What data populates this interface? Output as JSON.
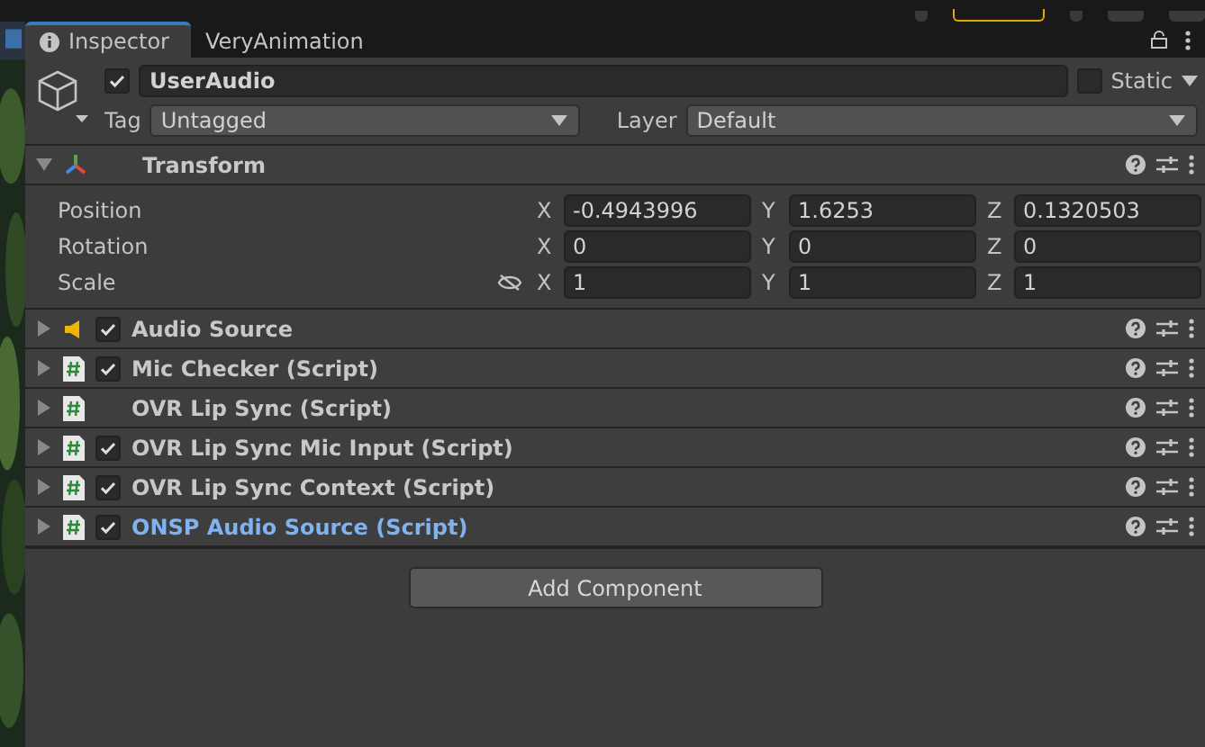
{
  "tabs": [
    {
      "label": "Inspector",
      "selected": true,
      "icon": true
    },
    {
      "label": "VeryAnimation",
      "selected": false,
      "icon": false
    }
  ],
  "object": {
    "active": true,
    "name": "UserAudio",
    "static": false,
    "static_label": "Static",
    "tag_label": "Tag",
    "tag": "Untagged",
    "layer_label": "Layer",
    "layer": "Default"
  },
  "transform": {
    "title": "Transform",
    "expanded": true,
    "rows": [
      {
        "label": "Position",
        "link_icon": false,
        "values": [
          {
            "axis": "X",
            "value": "-0.4943996"
          },
          {
            "axis": "Y",
            "value": "1.6253"
          },
          {
            "axis": "Z",
            "value": "0.1320503"
          }
        ]
      },
      {
        "label": "Rotation",
        "link_icon": false,
        "values": [
          {
            "axis": "X",
            "value": "0"
          },
          {
            "axis": "Y",
            "value": "0"
          },
          {
            "axis": "Z",
            "value": "0"
          }
        ]
      },
      {
        "label": "Scale",
        "link_icon": true,
        "values": [
          {
            "axis": "X",
            "value": "1"
          },
          {
            "axis": "Y",
            "value": "1"
          },
          {
            "axis": "Z",
            "value": "1"
          }
        ]
      }
    ]
  },
  "components": [
    {
      "kind": "audio",
      "title": "Audio Source",
      "has_toggle": true,
      "enabled": true,
      "added": false
    },
    {
      "kind": "script",
      "title": "Mic Checker (Script)",
      "has_toggle": true,
      "enabled": true,
      "added": false
    },
    {
      "kind": "script",
      "title": "OVR Lip Sync (Script)",
      "has_toggle": false,
      "added": false
    },
    {
      "kind": "script",
      "title": "OVR Lip Sync Mic Input (Script)",
      "has_toggle": true,
      "enabled": true,
      "added": false
    },
    {
      "kind": "script",
      "title": "OVR Lip Sync Context (Script)",
      "has_toggle": true,
      "enabled": true,
      "added": false
    },
    {
      "kind": "script",
      "title": "ONSP Audio Source (Script)",
      "has_toggle": true,
      "enabled": true,
      "added": true
    }
  ],
  "add_button": "Add Component"
}
